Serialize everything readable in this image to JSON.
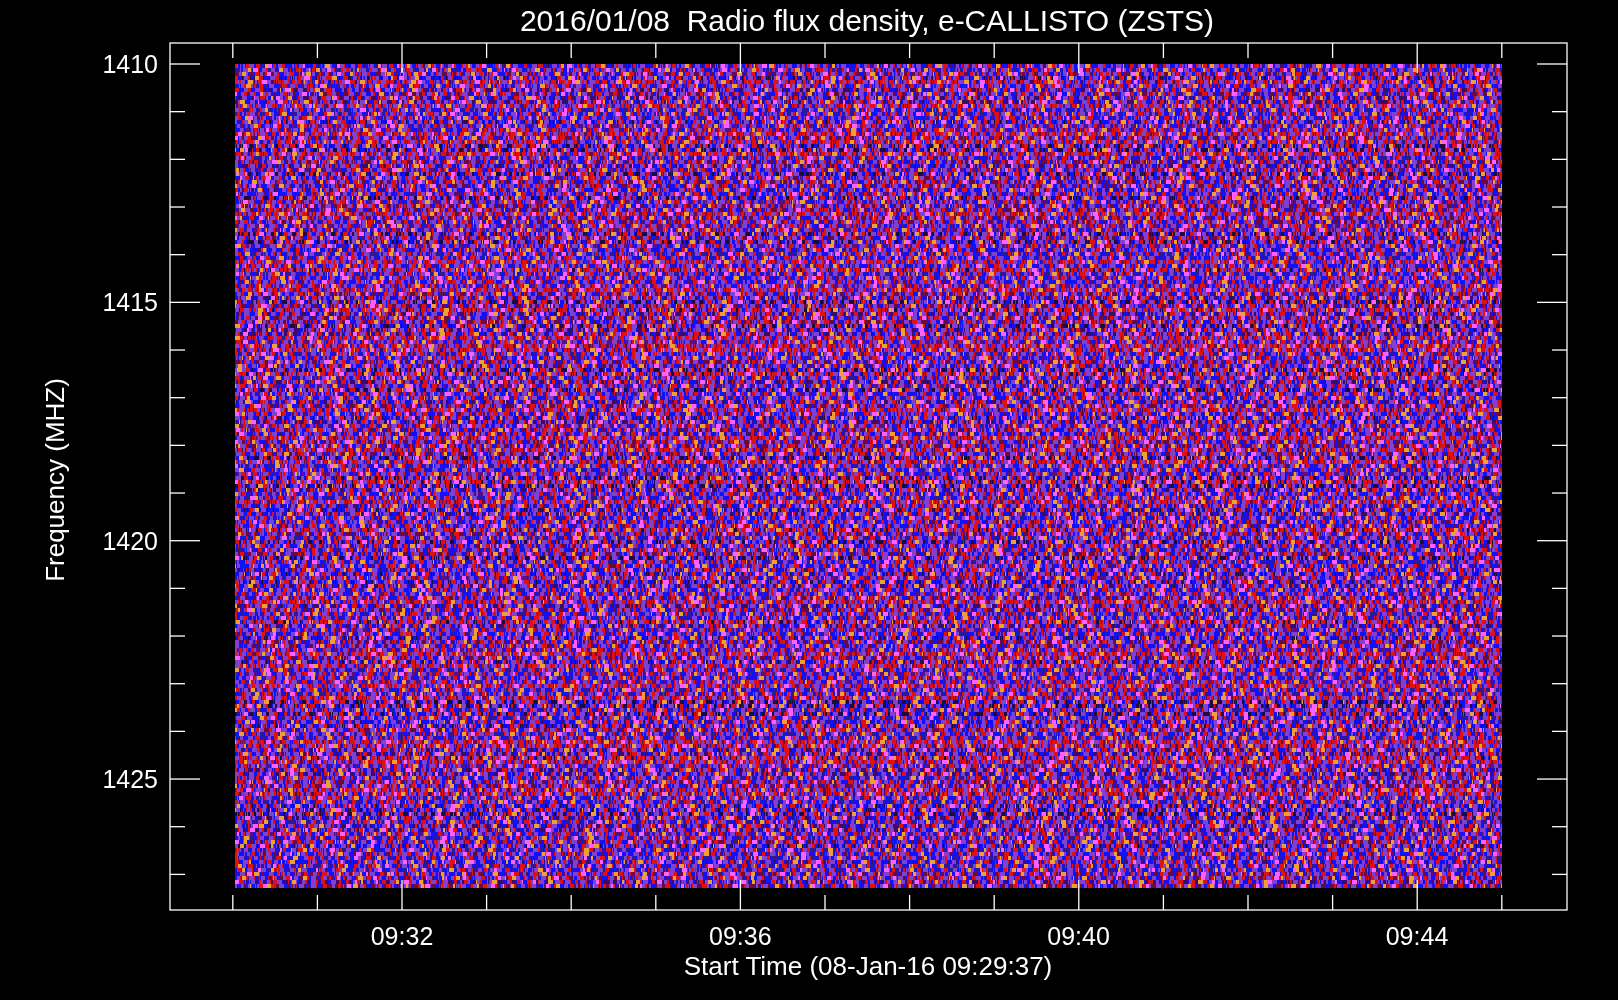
{
  "title": "2016/01/08  Radio flux density, e-CALLISTO (ZSTS)",
  "y_axis": {
    "label": "Frequency (MHZ)",
    "ticks": [
      "1410",
      "1415",
      "1420",
      "1425"
    ]
  },
  "x_axis": {
    "label": "Start Time (08-Jan-16 09:29:37)",
    "ticks": [
      "09:32",
      "09:36",
      "09:40",
      "09:44"
    ]
  }
}
